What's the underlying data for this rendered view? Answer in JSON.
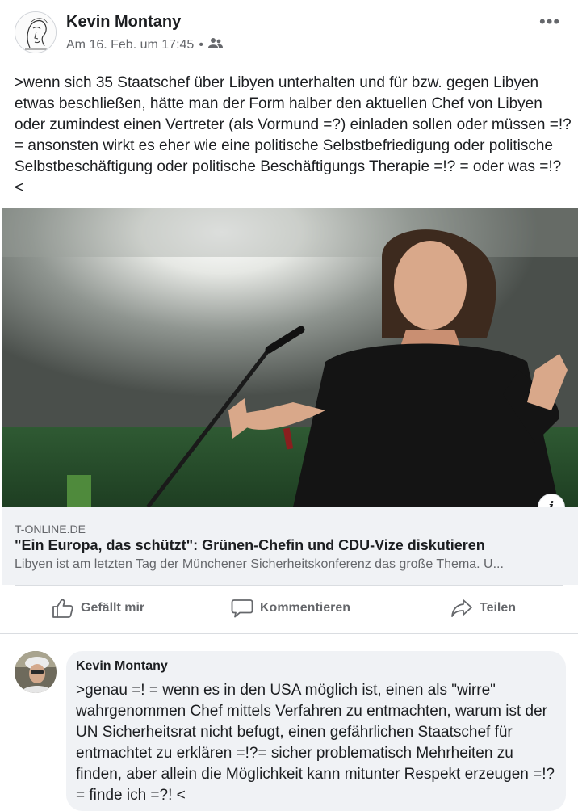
{
  "post": {
    "author": "Kevin Montany",
    "timestamp": "Am 16. Feb. um 17:45",
    "separator": "•",
    "audience_icon": "friends-icon",
    "more_icon": "more-horizontal-icon",
    "more_label": "•••",
    "text": ">wenn sich 35 Staatschef über Libyen unterhalten und für bzw. gegen Libyen etwas beschließen, hätte man der Form halber den aktuellen Chef von Libyen oder zumindest einen Vertreter (als  Vormund =?) einladen sollen oder müssen =!? = ansonsten wirkt es eher  wie eine politische Selbstbefriedigung oder politische Selbstbeschäftigung oder politische Beschäftigungs Therapie =!? = oder was =!? <"
  },
  "link_preview": {
    "info_label": "i",
    "domain": "T-ONLINE.DE",
    "title": "\"Ein Europa, das schützt\": Grünen-Chefin und CDU-Vize diskutieren",
    "description": "Libyen ist am letzten Tag der Münchener Sicherheitskonferenz das große Thema. U..."
  },
  "actions": {
    "like_label": "Gefällt mir",
    "comment_label": "Kommentieren",
    "share_label": "Teilen"
  },
  "comment": {
    "author": "Kevin Montany",
    "text": ">genau =! = wenn es in den USA möglich ist, einen als \"wirre\" wahrgenommen Chef mittels Verfahren zu entmachten, warum ist der UN Sicherheitsrat nicht befugt, einen gefährlichen Staatschef für entmachtet zu erklären =!?= sicher problematisch Mehrheiten zu finden, aber allein die Möglichkeit kann mitunter Respekt erzeugen =!? = finde ich =?! <"
  },
  "colors": {
    "secondary_text": "#65676b",
    "card_background": "#f0f2f5",
    "divider": "#dadde1"
  }
}
